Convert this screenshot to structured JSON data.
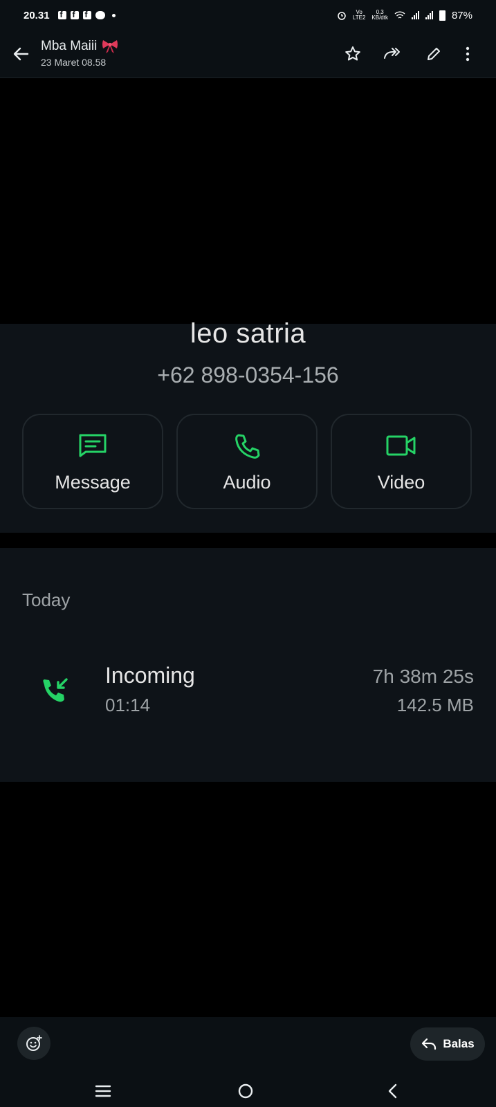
{
  "status_bar": {
    "time": "20.31",
    "network_top": "0,3",
    "network_bottom": "KB/dtk",
    "volte_top": "Vo",
    "volte_bottom": "LTE2",
    "battery": "87%"
  },
  "header": {
    "title": "Mba Maiii",
    "subtitle": "23 Maret 08.58"
  },
  "contact": {
    "name": "leo satria",
    "phone": "+62 898-0354-156",
    "actions": [
      {
        "label": "Message",
        "icon": "message-icon"
      },
      {
        "label": "Audio",
        "icon": "phone-icon"
      },
      {
        "label": "Video",
        "icon": "video-icon"
      }
    ]
  },
  "call_log": {
    "section": "Today",
    "entry": {
      "type": "Incoming",
      "time": "01:14",
      "duration": "7h 38m 25s",
      "size": "142.5 MB"
    }
  },
  "bottom": {
    "reply_label": "Balas"
  },
  "colors": {
    "accent": "#25d366",
    "background": "#0b1014",
    "card": "#0e1318"
  }
}
